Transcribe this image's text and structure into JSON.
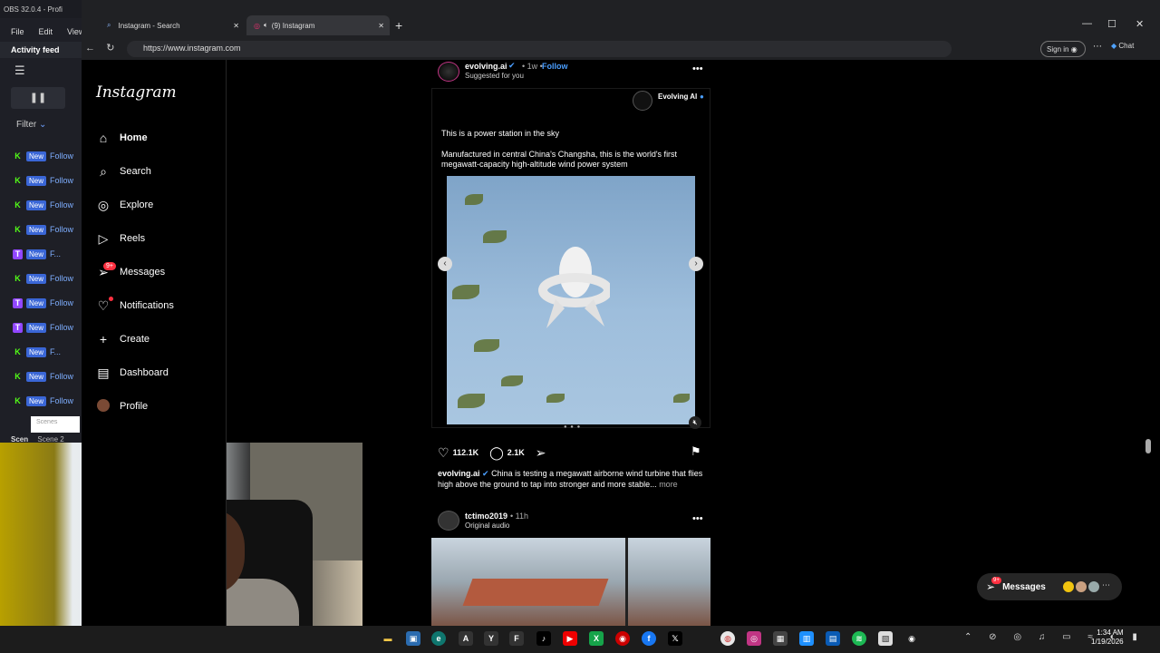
{
  "obs": {
    "title": "OBS 32.0.4 - Profi",
    "menu": [
      "File",
      "Edit",
      "View"
    ],
    "activity_feed": "Activity feed",
    "filter": "Filter",
    "feed_items": [
      {
        "platform": "K",
        "badge": "New",
        "text": "Follow"
      },
      {
        "platform": "K",
        "badge": "New",
        "text": "Follow"
      },
      {
        "platform": "K",
        "badge": "New",
        "text": "Follow"
      },
      {
        "platform": "K",
        "badge": "New",
        "text": "Follow"
      },
      {
        "platform": "T",
        "badge": "New",
        "text": "F..."
      },
      {
        "platform": "K",
        "badge": "New",
        "text": "Follow"
      },
      {
        "platform": "T",
        "badge": "New",
        "text": "Follow"
      },
      {
        "platform": "T",
        "badge": "New",
        "text": "Follow"
      },
      {
        "platform": "K",
        "badge": "New",
        "text": "F..."
      },
      {
        "platform": "K",
        "badge": "New",
        "text": "Follow"
      },
      {
        "platform": "K",
        "badge": "New",
        "text": "Follow"
      }
    ],
    "scenes_placeholder": "Scenes",
    "scene_label": "Scen",
    "scene_item": "Scene 2"
  },
  "browser": {
    "tabs": [
      {
        "label": "Instagram - Search"
      },
      {
        "label": "(9) Instagram"
      }
    ],
    "url": "https://www.instagram.com",
    "sign_in": "Sign in",
    "chat": "Chat"
  },
  "instagram": {
    "logo": "Instagram",
    "nav": [
      {
        "label": "Home",
        "icon": "home-icon"
      },
      {
        "label": "Search",
        "icon": "search-icon"
      },
      {
        "label": "Explore",
        "icon": "explore-icon"
      },
      {
        "label": "Reels",
        "icon": "reels-icon"
      },
      {
        "label": "Messages",
        "icon": "messages-icon"
      },
      {
        "label": "Notifications",
        "icon": "heart-icon"
      },
      {
        "label": "Create",
        "icon": "plus-icon"
      },
      {
        "label": "Dashboard",
        "icon": "dashboard-icon"
      },
      {
        "label": "Profile",
        "icon": "avatar"
      }
    ],
    "messages_badge": "9+",
    "post1": {
      "username": "evolving.ai",
      "time": "• 1w •",
      "follow": "Follow",
      "suggested": "Suggested for you",
      "brand": "Evolving AI",
      "caption_title": "This is a power station in the sky",
      "caption_body": "Manufactured in central China's Changsha, this is the world's first megawatt-capacity high-altitude wind power system",
      "likes": "112.1K",
      "comments": "2.1K",
      "description_user": "evolving.ai",
      "description": "China is testing a megawatt airborne wind turbine that flies high above the ground to tap into stronger and more stable...",
      "more": "more"
    },
    "post2": {
      "username": "tctimo2019",
      "time": "• 11h",
      "audio": "Original audio"
    },
    "messages_pill": "Messages",
    "messages_pill_badge": "9+"
  },
  "taskbar": {
    "time": "1:34 AM",
    "date": "1/19/2026"
  }
}
